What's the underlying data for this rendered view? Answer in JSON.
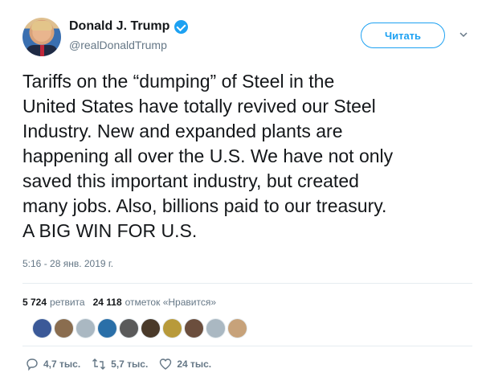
{
  "user": {
    "display_name": "Donald J. Trump",
    "handle": "@realDonaldTrump",
    "verified": true
  },
  "follow_button": {
    "label": "Читать"
  },
  "tweet": {
    "lines": [
      "Tariffs on the “dumping” of Steel in the",
      "United States have totally revived our Steel",
      "Industry. New and expanded plants are",
      "happening all over the U.S. We have not only",
      "saved this important industry, but created",
      "many jobs. Also, billions paid to our treasury.",
      "A BIG WIN FOR U.S."
    ],
    "timestamp": "5:16 - 28 янв. 2019 г."
  },
  "stats": {
    "retweets_count": "5 724",
    "retweets_label": "ретвита",
    "likes_count": "24 118",
    "likes_label": "отметок «Нравится»"
  },
  "liker_avatars": [
    {
      "color": "#3b5998"
    },
    {
      "color": "#8a6d4f"
    },
    {
      "color": "#aab8c2"
    },
    {
      "color": "#2a6fa8"
    },
    {
      "color": "#5a5a5a"
    },
    {
      "color": "#4a3a2a"
    },
    {
      "color": "#b89a3a"
    },
    {
      "color": "#6b4e3d"
    },
    {
      "color": "#aab8c2"
    },
    {
      "color": "#c7a27a"
    }
  ],
  "actions": {
    "reply_count": "4,7 тыс.",
    "retweet_count": "5,7 тыс.",
    "like_count": "24 тыс."
  },
  "colors": {
    "accent": "#1da1f2",
    "text": "#14171a",
    "secondary": "#657786",
    "divider": "#e6ecf0"
  }
}
